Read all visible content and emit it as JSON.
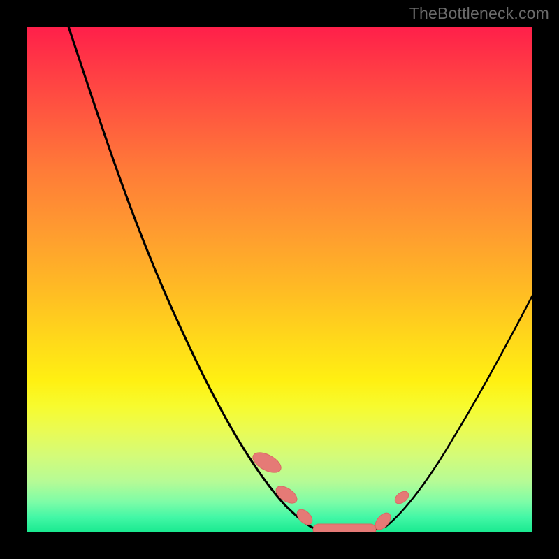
{
  "watermark": {
    "text": "TheBottleneck.com"
  },
  "colors": {
    "background": "#000000",
    "curve_stroke": "#000000",
    "marker_fill": "#e57a76",
    "marker_stroke": "#d96a64"
  },
  "chart_data": {
    "type": "line",
    "title": "",
    "xlabel": "",
    "ylabel": "",
    "xlim": [
      0,
      100
    ],
    "ylim": [
      0,
      100
    ],
    "note": "No axes, ticks, or numeric labels are rendered; values are visual estimates on a 0–100 normalized coordinate space matching the gradient plot area.",
    "series": [
      {
        "name": "left-curve",
        "x": [
          8,
          12,
          16,
          20,
          24,
          28,
          32,
          36,
          40,
          44,
          48,
          52,
          55
        ],
        "y": [
          100,
          93,
          85,
          77,
          69,
          60,
          52,
          43,
          34,
          25,
          16,
          8,
          2
        ]
      },
      {
        "name": "bottom-flat",
        "x": [
          55,
          59,
          63,
          67
        ],
        "y": [
          2,
          1,
          1,
          2
        ]
      },
      {
        "name": "right-curve",
        "x": [
          67,
          71,
          75,
          80,
          85,
          90,
          95,
          100
        ],
        "y": [
          2,
          7,
          14,
          22,
          31,
          40,
          48,
          56
        ]
      }
    ],
    "markers": {
      "name": "highlighted-points",
      "shape": "pill",
      "points": [
        {
          "x": 48,
          "y": 14,
          "len": 6
        },
        {
          "x": 51,
          "y": 7,
          "len": 5
        },
        {
          "x": 55,
          "y": 2,
          "len": 4
        },
        {
          "x": 62,
          "y": 1,
          "len": 12
        },
        {
          "x": 68,
          "y": 3,
          "len": 5
        },
        {
          "x": 72,
          "y": 9,
          "len": 4
        }
      ]
    }
  }
}
